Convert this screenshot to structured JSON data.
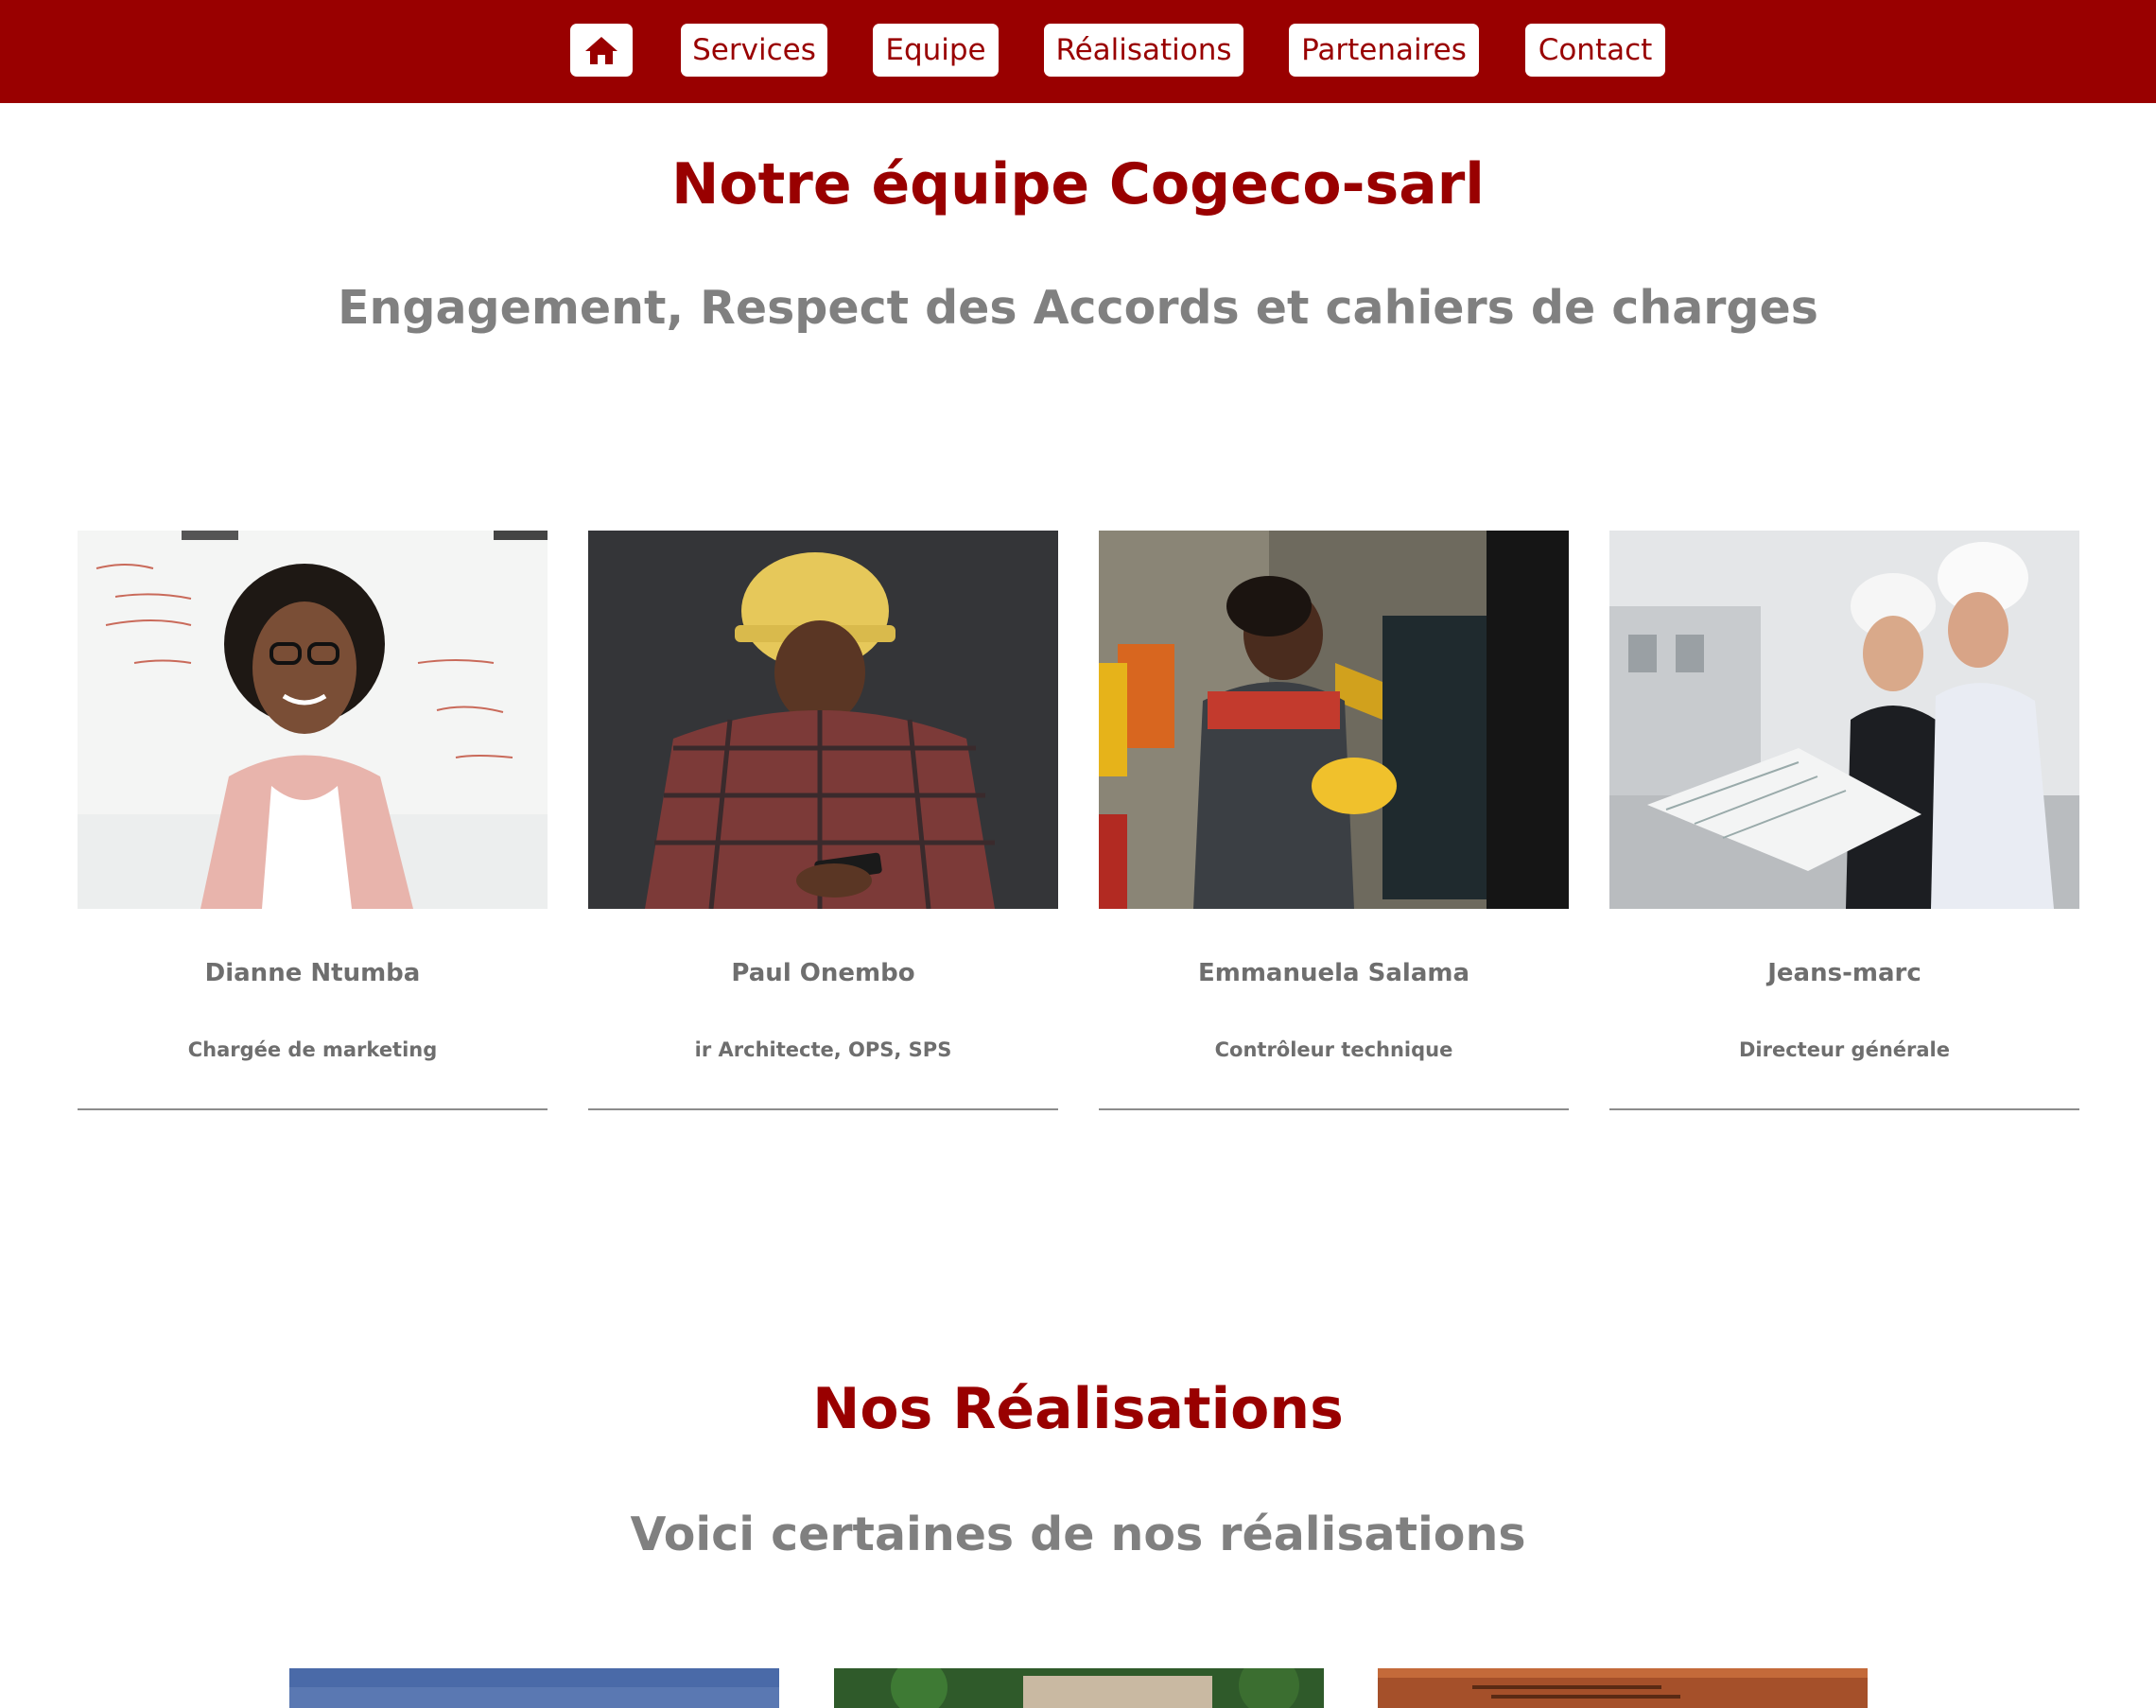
{
  "nav": {
    "home_icon": "home-icon",
    "items": [
      "Services",
      "Equipe",
      "Réalisations",
      "Partenaires",
      "Contact"
    ]
  },
  "team": {
    "title": "Notre équipe Cogeco-sarl",
    "subtitle": "Engagement, Respect des Accords et cahiers de charges",
    "members": [
      {
        "name": "Dianne Ntumba",
        "role": "Chargée de marketing"
      },
      {
        "name": "Paul Onembo",
        "role": "ir Architecte, OPS, SPS"
      },
      {
        "name": "Emmanuela Salama",
        "role": "Contrôleur technique"
      },
      {
        "name": "Jeans-marc",
        "role": "Directeur générale"
      }
    ]
  },
  "realisations": {
    "title": "Nos Réalisations",
    "subtitle": "Voici certaines de nos réalisations"
  },
  "colors": {
    "brand": "#990000",
    "subtitle_gray": "#808080",
    "text_gray": "#6e6e6e"
  }
}
